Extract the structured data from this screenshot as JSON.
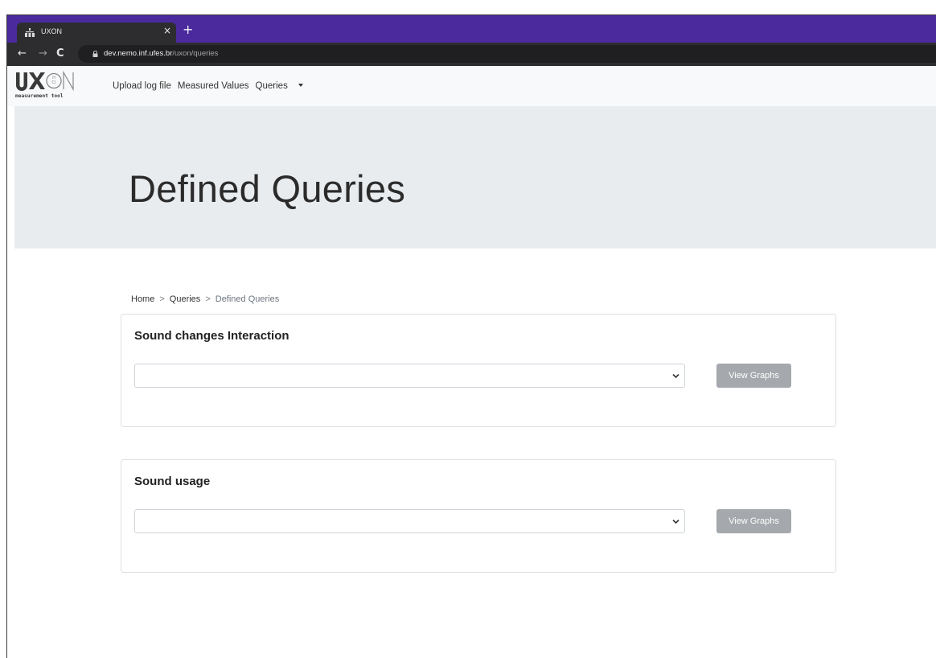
{
  "browser": {
    "tab_title": "UXON",
    "tab_close": "×",
    "new_tab": "+",
    "url_host": "dev.nemo.inf.ufes.br",
    "url_path": "/uxon/queries",
    "icons": {
      "back": "←",
      "forward": "→",
      "reload": "C"
    }
  },
  "navbar": {
    "links": [
      "Upload log file",
      "Measured Values",
      "Queries"
    ],
    "logo_text": "UX",
    "logo_subtitle": "measurement tool"
  },
  "jumbotron": {
    "title": "Defined Queries"
  },
  "breadcrumb": {
    "items": [
      "Home",
      "Queries",
      "Defined Queries"
    ],
    "separator": ">"
  },
  "cards": [
    {
      "title": "Sound changes Interaction",
      "select_value": "",
      "button_label": "View Graphs"
    },
    {
      "title": "Sound usage",
      "select_value": "",
      "button_label": "View Graphs"
    }
  ],
  "colors": {
    "tab_strip": "#4b2a9e",
    "button_disabled": "#a5a8ac",
    "jumbotron": "#e9ecef"
  }
}
